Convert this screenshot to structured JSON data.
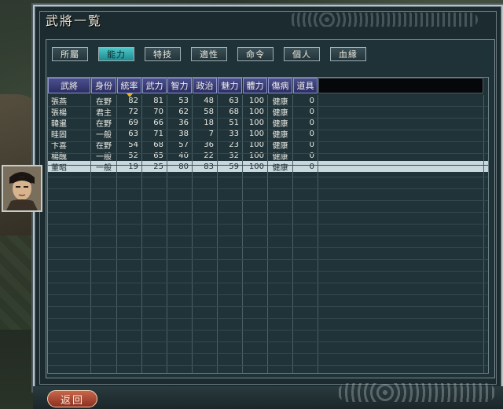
{
  "window": {
    "title": "武將一覧"
  },
  "tabs": [
    {
      "label": "所屬",
      "active": false
    },
    {
      "label": "能力",
      "active": true
    },
    {
      "label": "特技",
      "active": false
    },
    {
      "label": "適性",
      "active": false
    },
    {
      "label": "命令",
      "active": false
    },
    {
      "label": "個人",
      "active": false
    },
    {
      "label": "血縁",
      "active": false
    }
  ],
  "table": {
    "headers": [
      "武將",
      "身份",
      "統率",
      "武力",
      "智力",
      "政治",
      "魅力",
      "體力",
      "傷病",
      "道具"
    ],
    "sort_column": "統率",
    "rows": [
      {
        "name": "張燕",
        "rank": "在野",
        "lead": "82",
        "war": "81",
        "int": "53",
        "pol": "48",
        "chr": "63",
        "hp": "100",
        "status": "健康",
        "item": "0",
        "selected": false
      },
      {
        "name": "張楊",
        "rank": "君主",
        "lead": "72",
        "war": "70",
        "int": "62",
        "pol": "58",
        "chr": "68",
        "hp": "100",
        "status": "健康",
        "item": "0",
        "selected": false
      },
      {
        "name": "韓暹",
        "rank": "在野",
        "lead": "69",
        "war": "66",
        "int": "36",
        "pol": "18",
        "chr": "51",
        "hp": "100",
        "status": "健康",
        "item": "0",
        "selected": false
      },
      {
        "name": "眭固",
        "rank": "一般",
        "lead": "63",
        "war": "71",
        "int": "38",
        "pol": "7",
        "chr": "33",
        "hp": "100",
        "status": "健康",
        "item": "0",
        "selected": false
      },
      {
        "name": "卞喜",
        "rank": "在野",
        "lead": "54",
        "war": "68",
        "int": "57",
        "pol": "36",
        "chr": "23",
        "hp": "100",
        "status": "健康",
        "item": "0",
        "selected": false
      },
      {
        "name": "楊醜",
        "rank": "一般",
        "lead": "52",
        "war": "65",
        "int": "40",
        "pol": "22",
        "chr": "32",
        "hp": "100",
        "status": "健康",
        "item": "0",
        "selected": false
      },
      {
        "name": "董昭",
        "rank": "一般",
        "lead": "19",
        "war": "25",
        "int": "80",
        "pol": "83",
        "chr": "59",
        "hp": "100",
        "status": "健康",
        "item": "0",
        "selected": true
      }
    ]
  },
  "buttons": {
    "back": "返回"
  },
  "colors": {
    "tab_active": "#2fa9ab",
    "header_bg": "#3a3e7a",
    "selected_row": "#c9d8dd",
    "back_button": "#b0503a"
  }
}
